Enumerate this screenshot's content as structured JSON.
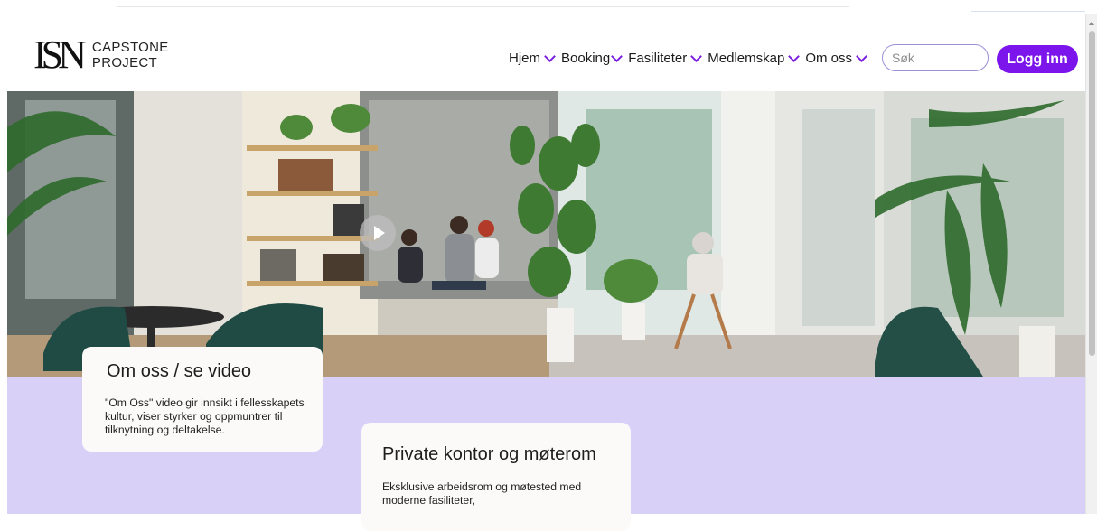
{
  "logo": {
    "mark": "ISN",
    "line1": "CAPSTONE",
    "line2": "PROJECT"
  },
  "nav": {
    "items": [
      {
        "label": "Hjem"
      },
      {
        "label": "Booking"
      },
      {
        "label": "Fasiliteter"
      },
      {
        "label": "Medlemskap"
      },
      {
        "label": "Om oss"
      }
    ],
    "dropdown_icon": "chevron-down-icon"
  },
  "search": {
    "placeholder": "Søk",
    "value": ""
  },
  "login": {
    "label": "Logg inn"
  },
  "hero": {
    "alt": "Coworking lounge with plants"
  },
  "cards": [
    {
      "title": "Om oss / se video",
      "text": "\"Om Oss\" video gir innsikt i fellesskapets kultur, viser styrker og oppmuntrer til tilknytning og deltakelse."
    },
    {
      "title": "Private kontor og møterom",
      "text": "Eksklusive arbeidsrom og møtested med moderne fasiliteter,"
    }
  ],
  "colors": {
    "accent": "#7c14ec",
    "section_bg": "#d8d0f7",
    "card_bg": "#fbfaf8"
  }
}
